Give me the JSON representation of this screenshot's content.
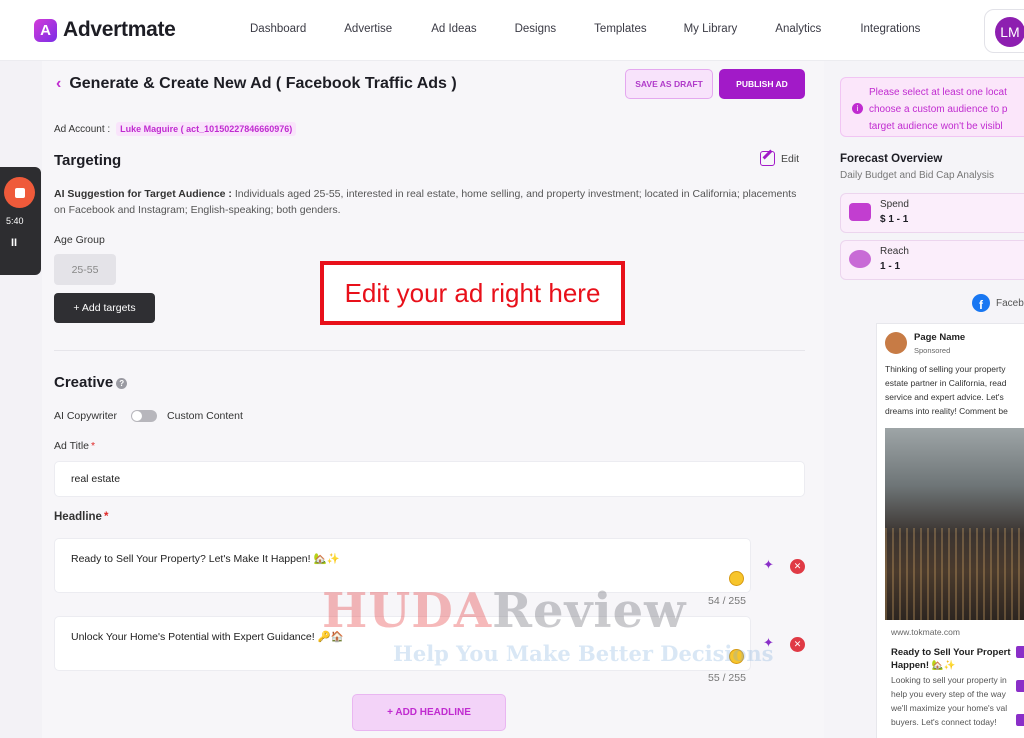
{
  "brand": {
    "logo_letter": "A",
    "name": "Advertmate"
  },
  "nav": [
    "Dashboard",
    "Advertise",
    "Ad Ideas",
    "Designs",
    "Templates",
    "My Library",
    "Analytics",
    "Integrations"
  ],
  "user": {
    "initials": "LM"
  },
  "page": {
    "back_icon": "‹",
    "title": "Generate & Create New Ad ( Facebook Traffic Ads )",
    "save_draft": "SAVE AS DRAFT",
    "publish": "PUBLISH AD",
    "ad_account_label": "Ad Account :",
    "ad_account_value": "Luke Maguire ( act_10150227846660976)"
  },
  "targeting": {
    "heading": "Targeting",
    "edit": "Edit",
    "ai_label": "AI Suggestion for Target Audience :",
    "ai_text": "Individuals aged 25-55, interested in real estate, home selling, and property investment; located in California; placements on Facebook and Instagram; English-speaking; both genders.",
    "age_label": "Age Group",
    "age_value": "25-55",
    "add_targets": "+ Add targets"
  },
  "callout": "Edit your ad right here",
  "creative": {
    "heading": "Creative",
    "help": "?",
    "toggle_left": "AI Copywriter",
    "toggle_right": "Custom Content",
    "ad_title_label": "Ad Title",
    "required": "*",
    "ad_title_value": "real estate",
    "headline_label": "Headline",
    "headlines": [
      {
        "text": "Ready to Sell Your Property? Let's Make It Happen! 🏡✨",
        "count": "54 / 255"
      },
      {
        "text": "Unlock Your Home's Potential with Expert Guidance! 🔑🏠",
        "count": "55 / 255"
      }
    ],
    "add_headline": "+ ADD HEADLINE"
  },
  "watermark": {
    "line1_red": "HUDA",
    "line1_grey": "Review",
    "line2": "Help You Make Better Decisions"
  },
  "recorder": {
    "time": "5:40",
    "pause": "II"
  },
  "right": {
    "notice_icon": "i",
    "notice_lines": [
      "Please select at least one locat",
      "choose a custom audience to p",
      "target audience won't be visibl"
    ],
    "forecast_title": "Forecast Overview",
    "forecast_sub": "Daily Budget and Bid Cap Analysis",
    "spend_label": "Spend",
    "spend_value": "$ 1 - 1",
    "reach_label": "Reach",
    "reach_value": "1 - 1",
    "fb_logo": "f",
    "fb_label": "Faceb",
    "preview": {
      "page_name": "Page Name",
      "sponsored": "Sponsored",
      "body_lines": [
        "Thinking of selling your property",
        "estate partner in California, read",
        "service and expert advice. Let's",
        "dreams into reality! Comment be"
      ],
      "url": "www.tokmate.com",
      "headline_lines": [
        "Ready to Sell Your Propert",
        "Happen! 🏡✨"
      ],
      "desc_lines": [
        "Looking to sell your property in",
        "help you every step of the way",
        "we'll maximize your home's val",
        "buyers. Let's connect today!"
      ]
    }
  },
  "colors": {
    "accent": "#a21ac8",
    "accent_light": "#f8e3fb",
    "callout": "#e8101a"
  }
}
